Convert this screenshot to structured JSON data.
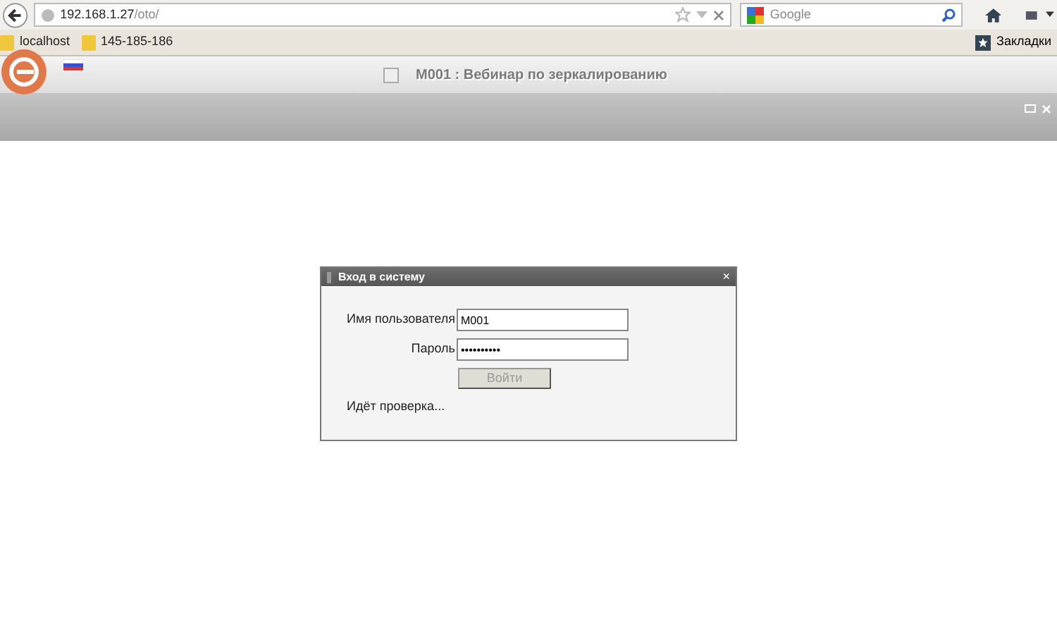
{
  "browser": {
    "url_host": "192.168.1.27",
    "url_path": "/oto/",
    "search_placeholder": "Google"
  },
  "bookmarks": [
    {
      "label": "localhost"
    },
    {
      "label": "145-185-186"
    }
  ],
  "bookmarks_menu": "Закладки",
  "app_header": {
    "title": "M001 : Вебинар по зеркалированию"
  },
  "login_dialog": {
    "title": "Вход в систему",
    "close": "×",
    "username_label": "Имя пользователя",
    "username": "M001",
    "password_label": "Пароль",
    "password": "••••••••••",
    "submit": {
      "label": "Войти",
      "disabled": true
    },
    "status": "Идёт проверка..."
  }
}
